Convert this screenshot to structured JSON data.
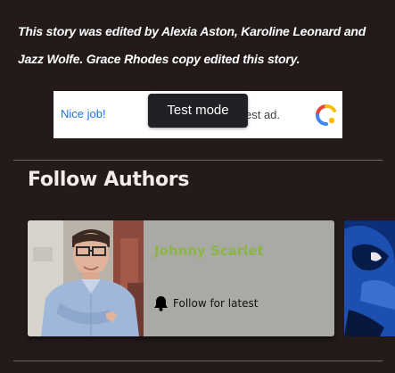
{
  "article": {
    "editor_note": "This story was edited by Alexia Aston, Karoline Leonard and Jazz Wolfe. Grace Rhodes copy edited this story."
  },
  "ad": {
    "headline": "Nice job!",
    "body_fragment": "est ad.",
    "test_mode_label": "Test mode",
    "logo_icon": "google-ads-icon"
  },
  "follow_authors": {
    "title": "Follow Authors",
    "cards": [
      {
        "name": "Johnny Scarlet",
        "follow_label": "Follow for latest",
        "icon": "bell-icon"
      }
    ]
  },
  "colors": {
    "background": "#231a19",
    "author_name": "#8cb545",
    "card": "#a9a9a6",
    "ad_link": "#1a73e8"
  }
}
